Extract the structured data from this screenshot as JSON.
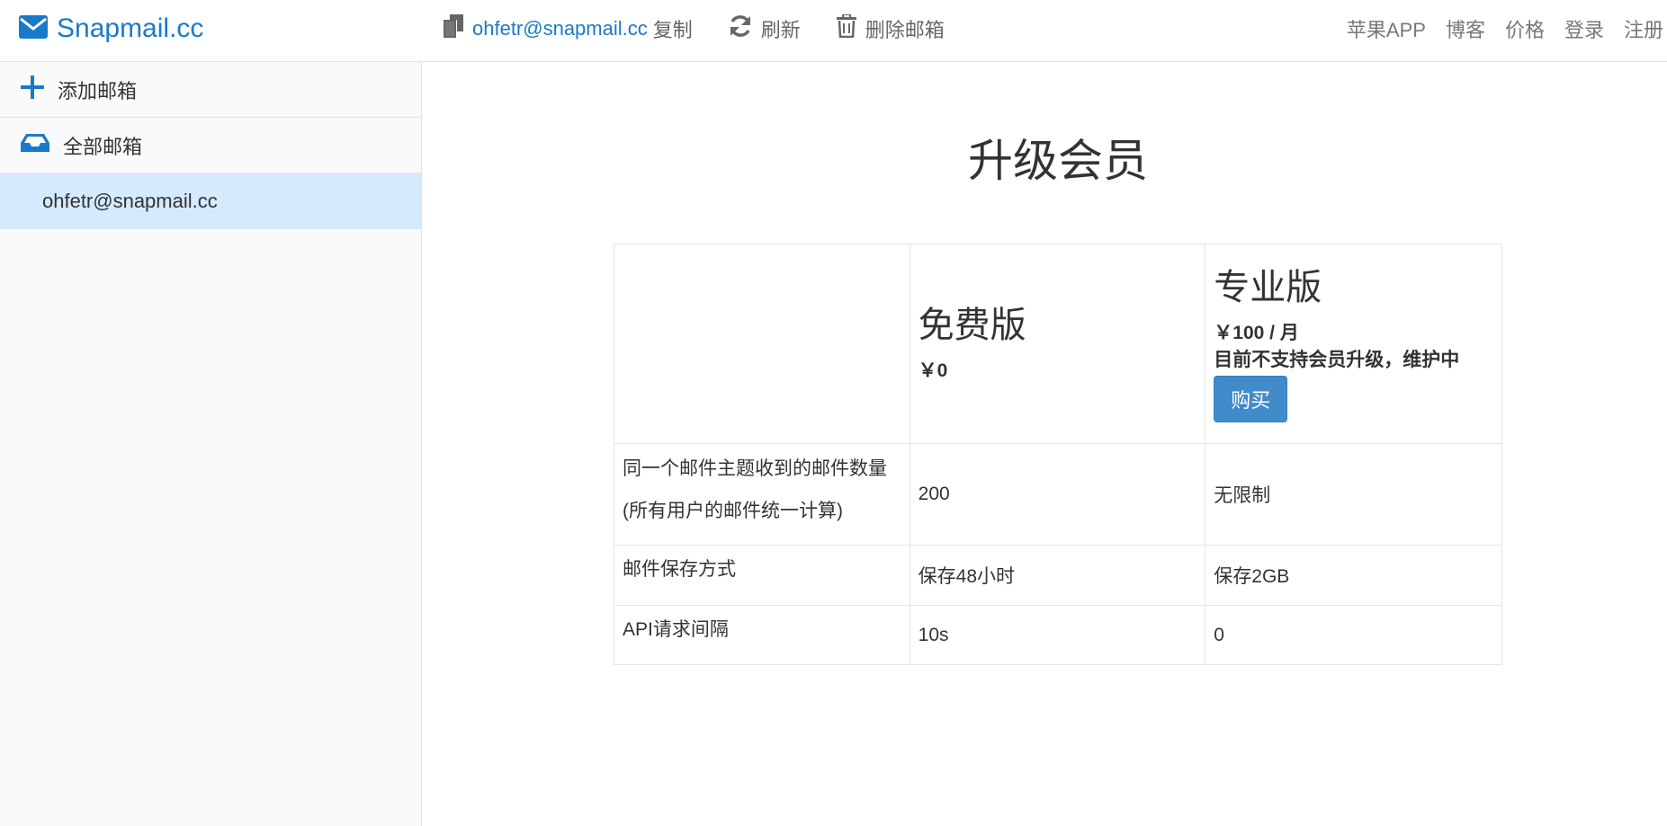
{
  "brand": {
    "name": "Snapmail.cc",
    "icon": "envelope-icon"
  },
  "toolbar": {
    "email": "ohfetr@snapmail.cc",
    "copy_label": "复制",
    "refresh_label": "刷新",
    "delete_label": "删除邮箱"
  },
  "nav": {
    "apple_app": "苹果APP",
    "blog": "博客",
    "pricing": "价格",
    "login": "登录",
    "register": "注册"
  },
  "sidebar": {
    "add_mailbox": "添加邮箱",
    "all_mailboxes": "全部邮箱",
    "active_mailbox": "ohfetr@snapmail.cc"
  },
  "main": {
    "title": "升级会员",
    "plans": {
      "free": {
        "name": "免费版",
        "price": "￥0"
      },
      "pro": {
        "name": "专业版",
        "price": "￥100 / 月",
        "note": "目前不支持会员升级，维护中",
        "buy_label": "购买"
      }
    },
    "rows": [
      {
        "feature_line1": "同一个邮件主题收到的邮件数量",
        "feature_line2": "(所有用户的邮件统一计算)",
        "free": "200",
        "pro": "无限制"
      },
      {
        "feature": "邮件保存方式",
        "free": "保存48小时",
        "pro": "保存2GB"
      },
      {
        "feature": "API请求间隔",
        "free": "10s",
        "pro": "0"
      }
    ]
  },
  "colors": {
    "brand_blue": "#1a7ac9",
    "button_blue": "#428bca",
    "active_row": "#d4eafd"
  }
}
